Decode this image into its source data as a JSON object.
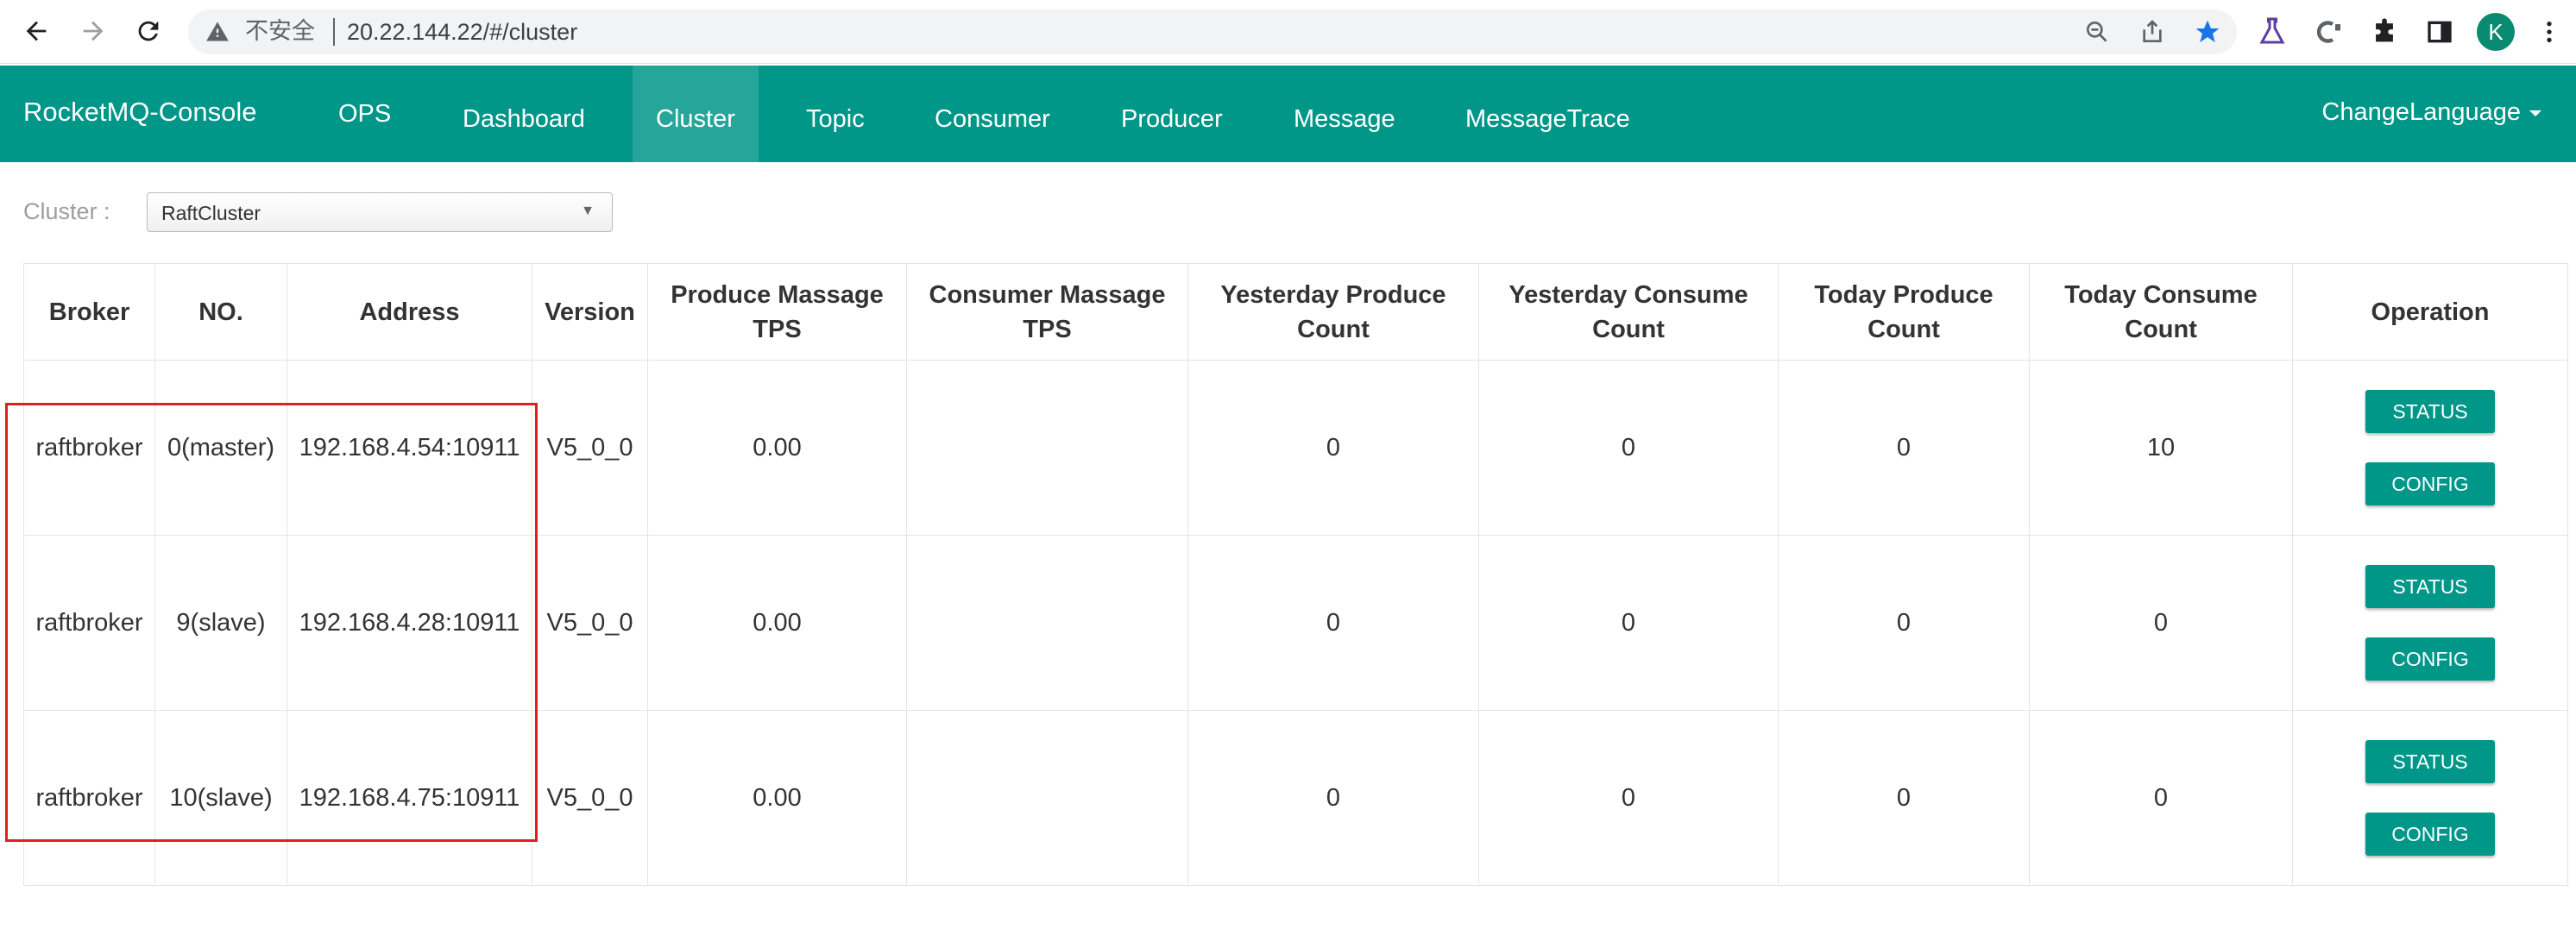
{
  "browser": {
    "insecure_label": "不安全",
    "url": "20.22.144.22/#/cluster",
    "profile_initial": "K"
  },
  "navbar": {
    "brand": "RocketMQ-Console",
    "items": [
      {
        "label": "OPS",
        "active": false
      },
      {
        "label": "Dashboard",
        "active": false
      },
      {
        "label": "Cluster",
        "active": true
      },
      {
        "label": "Topic",
        "active": false
      },
      {
        "label": "Consumer",
        "active": false
      },
      {
        "label": "Producer",
        "active": false
      },
      {
        "label": "Message",
        "active": false
      },
      {
        "label": "MessageTrace",
        "active": false
      }
    ],
    "language": "ChangeLanguage"
  },
  "cluster_selector": {
    "label": "Cluster :",
    "value": "RaftCluster"
  },
  "table": {
    "headers": {
      "broker": "Broker",
      "no": "NO.",
      "address": "Address",
      "version": "Version",
      "produce_tps": "Produce Massage TPS",
      "consumer_tps": "Consumer Massage TPS",
      "yesterday_produce": "Yesterday Produce Count",
      "yesterday_consume": "Yesterday Consume Count",
      "today_produce": "Today Produce Count",
      "today_consume": "Today Consume Count",
      "operation": "Operation"
    },
    "rows": [
      {
        "broker": "raftbroker",
        "no": "0(master)",
        "address": "192.168.4.54:10911",
        "version": "V5_0_0",
        "produce_tps": "0.00",
        "consumer_tps": "",
        "yesterday_produce": "0",
        "yesterday_consume": "0",
        "today_produce": "0",
        "today_consume": "10"
      },
      {
        "broker": "raftbroker",
        "no": "9(slave)",
        "address": "192.168.4.28:10911",
        "version": "V5_0_0",
        "produce_tps": "0.00",
        "consumer_tps": "",
        "yesterday_produce": "0",
        "yesterday_consume": "0",
        "today_produce": "0",
        "today_consume": "0"
      },
      {
        "broker": "raftbroker",
        "no": "10(slave)",
        "address": "192.168.4.75:10911",
        "version": "V5_0_0",
        "produce_tps": "0.00",
        "consumer_tps": "",
        "yesterday_produce": "0",
        "yesterday_consume": "0",
        "today_produce": "0",
        "today_consume": "0"
      }
    ],
    "buttons": {
      "status": "STATUS",
      "config": "CONFIG"
    }
  },
  "colors": {
    "navbar": "#009688",
    "navbar_active": "#26a69a",
    "button": "#009688",
    "highlight": "#e02020"
  }
}
